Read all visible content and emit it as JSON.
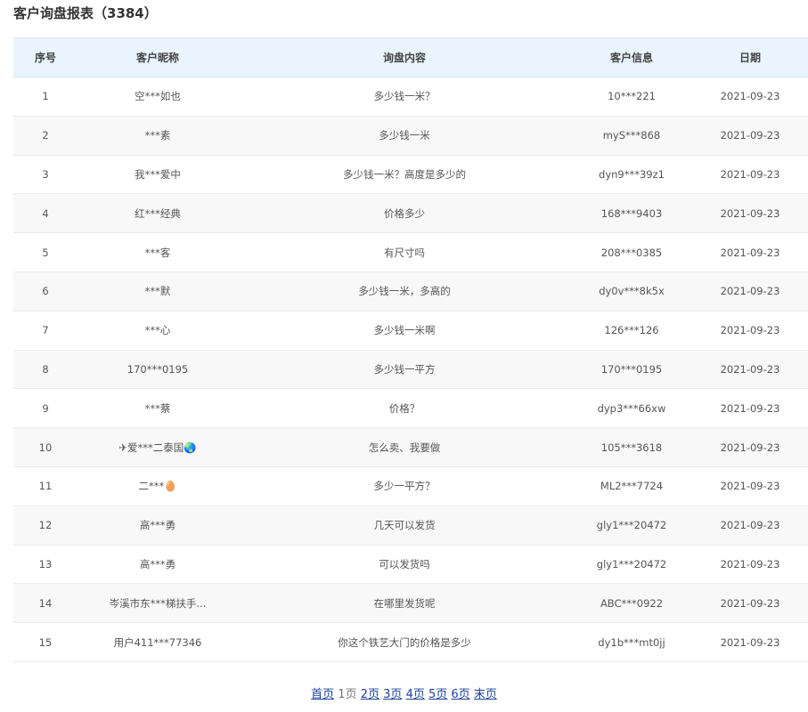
{
  "report": {
    "title": "客户询盘报表（3384）"
  },
  "table": {
    "headers": {
      "index": "序号",
      "nickname": "客户昵称",
      "content": "询盘内容",
      "info": "客户信息",
      "date": "日期"
    },
    "rows": [
      {
        "index": "1",
        "nickname": "空***如也",
        "content": "多少钱一米？",
        "info": "10***221",
        "date": "2021-09-23"
      },
      {
        "index": "2",
        "nickname": "***素",
        "content": "多少钱一米",
        "info": "myS***868",
        "date": "2021-09-23"
      },
      {
        "index": "3",
        "nickname": "我***爱中",
        "content": "多少钱一米？高度是多少的",
        "info": "dyn9***39z1",
        "date": "2021-09-23"
      },
      {
        "index": "4",
        "nickname": "红***经典",
        "content": "价格多少",
        "info": "168***9403",
        "date": "2021-09-23"
      },
      {
        "index": "5",
        "nickname": "***客",
        "content": "有尺寸吗",
        "info": "208***0385",
        "date": "2021-09-23"
      },
      {
        "index": "6",
        "nickname": "***默",
        "content": "多少钱一米，多高的",
        "info": "dy0v***8k5x",
        "date": "2021-09-23"
      },
      {
        "index": "7",
        "nickname": "***心",
        "content": "多少钱一米啊",
        "info": "126***126",
        "date": "2021-09-23"
      },
      {
        "index": "8",
        "nickname": "170***0195",
        "content": "多少钱一平方",
        "info": "170***0195",
        "date": "2021-09-23"
      },
      {
        "index": "9",
        "nickname": "***蔡",
        "content": "价格？",
        "info": "dyp3***66xw",
        "date": "2021-09-23"
      },
      {
        "index": "10",
        "nickname": "✈爱***二泰国🌏",
        "content": "怎么卖、我要做",
        "info": "105***3618",
        "date": "2021-09-23"
      },
      {
        "index": "11",
        "nickname": "二***🥚",
        "content": "多少一平方？",
        "info": "ML2***7724",
        "date": "2021-09-23"
      },
      {
        "index": "12",
        "nickname": "高***勇",
        "content": "几天可以发货",
        "info": "gly1***20472",
        "date": "2021-09-23"
      },
      {
        "index": "13",
        "nickname": "高***勇",
        "content": "可以发货吗",
        "info": "gly1***20472",
        "date": "2021-09-23"
      },
      {
        "index": "14",
        "nickname": "岑溪市东***梯扶手...",
        "content": "在哪里发货呢",
        "info": "ABC***0922",
        "date": "2021-09-23"
      },
      {
        "index": "15",
        "nickname": "用户411***77346",
        "content": "你这个铁艺大门的价格是多少",
        "info": "dy1b***mt0jj",
        "date": "2021-09-23"
      }
    ]
  },
  "pagination": {
    "first": "首页",
    "current": "1页",
    "pages": [
      "2页",
      "3页",
      "4页",
      "5页",
      "6页"
    ],
    "last": "末页"
  }
}
